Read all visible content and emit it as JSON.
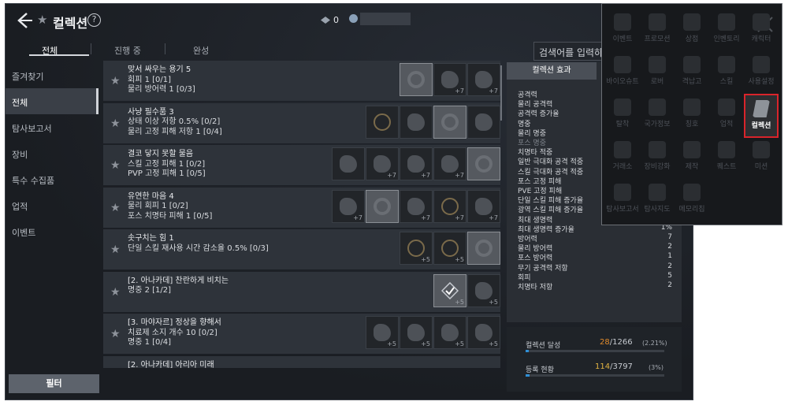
{
  "header": {
    "title": "컬렉션",
    "help": "?",
    "currency_value": "0"
  },
  "tabs": [
    {
      "label": "전체",
      "active": true
    },
    {
      "label": "진행 중",
      "active": false
    },
    {
      "label": "완성",
      "active": false
    }
  ],
  "search": {
    "placeholder": "검색어를 입력하세"
  },
  "sidebar": {
    "items": [
      "즐겨찾기",
      "전체",
      "탐사보고서",
      "장비",
      "특수 수집품",
      "업적",
      "이벤트"
    ],
    "active_index": 1,
    "filter_label": "필터"
  },
  "collections": [
    {
      "name": "맞서 싸우는 용기 5",
      "lines": [
        "회피 1 [0/1]",
        "물리 방어력 1 [0/3]"
      ],
      "items": [
        {
          "icon": "ring",
          "plus": "",
          "hl": true
        },
        {
          "icon": "blob",
          "plus": "+7",
          "hl": false
        },
        {
          "icon": "blob",
          "plus": "+7",
          "hl": false
        }
      ]
    },
    {
      "name": "사냥 필수품 3",
      "lines": [
        "상태 이상 저항 0.5% [0/2]",
        "물리 고정 피해 저항 1 [0/4]"
      ],
      "items": [
        {
          "icon": "pend",
          "plus": "",
          "hl": false
        },
        {
          "icon": "blob",
          "plus": "",
          "hl": false
        },
        {
          "icon": "ring",
          "plus": "",
          "hl": true
        },
        {
          "icon": "blob",
          "plus": "",
          "hl": false
        }
      ]
    },
    {
      "name": "결코 닿지 못할 물음",
      "lines": [
        "스킬 고정 피해 1 [0/2]",
        "PVP 고정 피해 1 [0/5]"
      ],
      "items": [
        {
          "icon": "blob",
          "plus": "",
          "hl": false
        },
        {
          "icon": "blob",
          "plus": "+7",
          "hl": false
        },
        {
          "icon": "blob",
          "plus": "+7",
          "hl": false
        },
        {
          "icon": "blob",
          "plus": "+7",
          "hl": false
        },
        {
          "icon": "ring",
          "plus": "",
          "hl": true
        }
      ]
    },
    {
      "name": "유연한 마음 4",
      "lines": [
        "물리 회피 1 [0/2]",
        "포스 치명타 피해 1 [0/5]"
      ],
      "items": [
        {
          "icon": "blob",
          "plus": "+7",
          "hl": false
        },
        {
          "icon": "ring",
          "plus": "",
          "hl": true
        },
        {
          "icon": "blob",
          "plus": "+7",
          "hl": false
        },
        {
          "icon": "pend",
          "plus": "+7",
          "hl": false
        },
        {
          "icon": "blob",
          "plus": "+7",
          "hl": false
        }
      ]
    },
    {
      "name": "솟구치는 힘 1",
      "lines": [
        "단일 스킬 재사용 시간 감소율 0.5% [0/3]"
      ],
      "items": [
        {
          "icon": "pend",
          "plus": "+5",
          "hl": false
        },
        {
          "icon": "pend",
          "plus": "+5",
          "hl": false
        },
        {
          "icon": "ring",
          "plus": "",
          "hl": true
        }
      ]
    },
    {
      "name": "[2. 아나카데] 찬란하게 비치는",
      "lines": [
        "명중 2 [1/2]"
      ],
      "items": [
        {
          "icon": "check",
          "plus": "+5",
          "hl": true
        },
        {
          "icon": "blob",
          "plus": "+5",
          "hl": false
        }
      ]
    },
    {
      "name": "[3. 마야자르] 정상을 향해서",
      "lines": [
        "치료제 소지 개수 10 [0/2]",
        "명중 1 [0/4]"
      ],
      "items": [
        {
          "icon": "blob",
          "plus": "+5",
          "hl": false
        },
        {
          "icon": "blob",
          "plus": "+5",
          "hl": false
        },
        {
          "icon": "blob",
          "plus": "+5",
          "hl": false
        },
        {
          "icon": "blob",
          "plus": "+5",
          "hl": false
        }
      ]
    },
    {
      "name": "[2. 아나카데] 아리아 미래",
      "lines": [],
      "items": []
    }
  ],
  "effects": {
    "button_label": "컬렉션 효과",
    "stats": [
      {
        "name": "공격력",
        "value": ""
      },
      {
        "name": "물리 공격력",
        "value": ""
      },
      {
        "name": "공격력 증가율",
        "value": ""
      },
      {
        "name": "명중",
        "value": ""
      },
      {
        "name": "물리 명중",
        "value": ""
      },
      {
        "name": "포스 명중",
        "value": "",
        "dim": true
      },
      {
        "name": "치명타 적중",
        "value": ""
      },
      {
        "name": "일반 극대화 공격 적중",
        "value": ""
      },
      {
        "name": "스킬 극대화 공격 적중",
        "value": ""
      },
      {
        "name": "포스 고정 피해",
        "value": ""
      },
      {
        "name": "PVE 고정 피해",
        "value": ""
      },
      {
        "name": "단일 스킬 피해 증가율",
        "value": ""
      },
      {
        "name": "광역 스킬 피해 증가율",
        "value": ""
      },
      {
        "name": "최대 생명력",
        "value": "90"
      },
      {
        "name": "최대 생명력 증가율",
        "value": "1%"
      },
      {
        "name": "방어력",
        "value": "7"
      },
      {
        "name": "물리 방어력",
        "value": "2"
      },
      {
        "name": "포스 방어력",
        "value": "1"
      },
      {
        "name": "무기 공격력 저항",
        "value": "2"
      },
      {
        "name": "회피",
        "value": "5"
      },
      {
        "name": "치명타 저항",
        "value": "2"
      }
    ]
  },
  "progress": {
    "achieved_label": "컬렉션 달성",
    "achieved_current": "28",
    "achieved_total": "/1266",
    "achieved_pct": "(2.21%)",
    "achieved_fraction": 0.0221,
    "registered_label": "등록 현황",
    "registered_current": "114",
    "registered_total": "/3797",
    "registered_pct": "(3%)",
    "registered_fraction": 0.03
  },
  "menu": {
    "items": [
      {
        "label": "이벤트",
        "highlight": false
      },
      {
        "label": "프로모션",
        "highlight": false
      },
      {
        "label": "상점",
        "highlight": false
      },
      {
        "label": "인벤토리",
        "highlight": false
      },
      {
        "label": "캐릭터",
        "highlight": false
      },
      {
        "label": "바이오슈트",
        "highlight": false
      },
      {
        "label": "로버",
        "highlight": false
      },
      {
        "label": "격납고",
        "highlight": false
      },
      {
        "label": "스킬",
        "highlight": false
      },
      {
        "label": "사용설정",
        "highlight": false
      },
      {
        "label": "탈착",
        "highlight": false
      },
      {
        "label": "국가정보",
        "highlight": false
      },
      {
        "label": "칭호",
        "highlight": false
      },
      {
        "label": "업적",
        "highlight": false
      },
      {
        "label": "컬렉션",
        "highlight": true
      },
      {
        "label": "거래소",
        "highlight": false
      },
      {
        "label": "장비강화",
        "highlight": false
      },
      {
        "label": "제작",
        "highlight": false
      },
      {
        "label": "퀘스트",
        "highlight": false
      },
      {
        "label": "미션",
        "highlight": false
      },
      {
        "label": "탐사보고서",
        "highlight": false
      },
      {
        "label": "탐사지도",
        "highlight": false
      },
      {
        "label": "메모리칩",
        "highlight": false
      }
    ],
    "accent": "#d9242b"
  }
}
